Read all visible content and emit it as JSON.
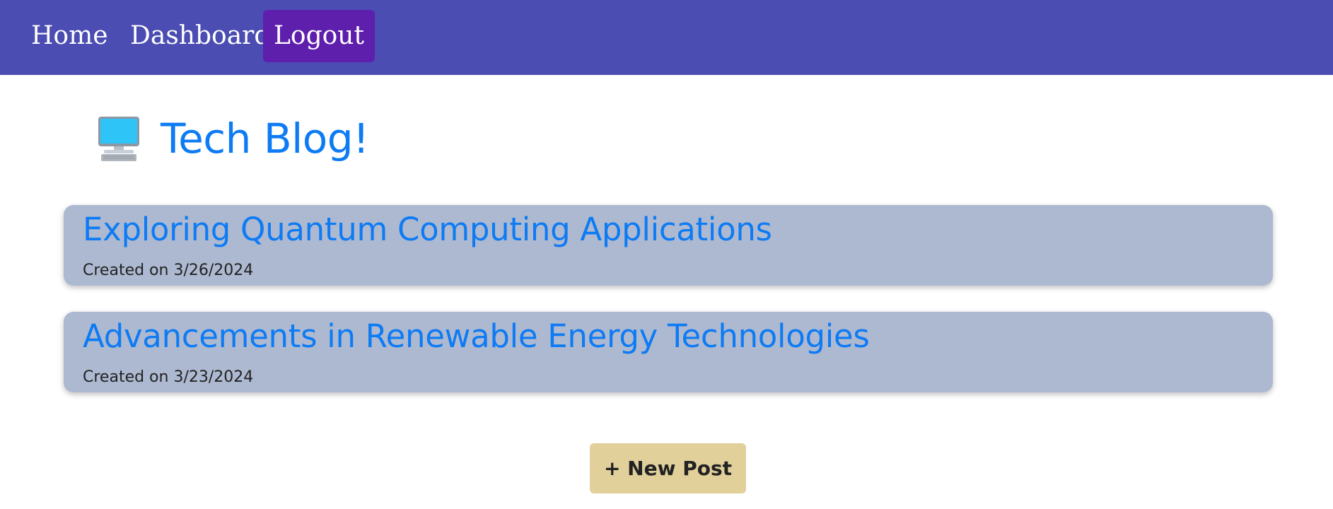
{
  "nav": {
    "home_label": "Home",
    "dashboard_label": "Dashboard",
    "logout_label": "Logout"
  },
  "header": {
    "title": "Tech Blog!",
    "icon": "desktop-computer-icon"
  },
  "posts": [
    {
      "title": "Exploring Quantum Computing Applications",
      "date_text": "Created on 3/26/2024"
    },
    {
      "title": "Advancements in Renewable Energy Technologies",
      "date_text": "Created on 3/23/2024"
    }
  ],
  "actions": {
    "new_post_label": "+ New Post"
  },
  "colors": {
    "navbar": "#4b4db2",
    "logout_active": "#5e1fad",
    "link_blue": "#0d7bf4",
    "card_bg": "#adb9d1",
    "button_bg": "#e2d09b"
  }
}
